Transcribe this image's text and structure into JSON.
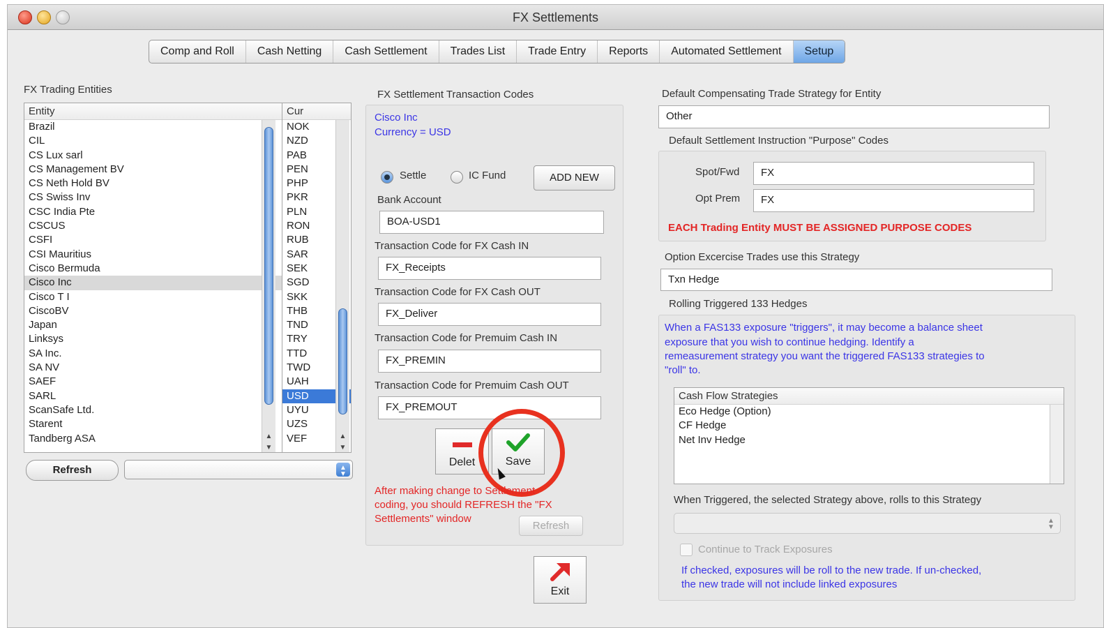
{
  "window": {
    "title": "FX Settlements"
  },
  "tabs": [
    "Comp and Roll",
    "Cash Netting",
    "Cash Settlement",
    "Trades List",
    "Trade Entry",
    "Reports",
    "Automated Settlement",
    "Setup"
  ],
  "entities": {
    "section_label": "FX Trading Entities",
    "entity_header": "Entity",
    "currency_header": "Cur",
    "entity_items": [
      "Brazil",
      "CIL",
      "CS Lux sarl",
      "CS Management BV",
      "CS Neth Hold BV",
      "CS Swiss Inv",
      "CSC India Pte",
      "CSCUS",
      "CSFI",
      "CSI Mauritius",
      "Cisco Bermuda",
      "Cisco Inc",
      "Cisco T I",
      "CiscoBV",
      "Japan",
      "Linksys",
      "SA Inc.",
      "SA NV",
      "SAEF",
      "SARL",
      "ScanSafe Ltd.",
      "Starent",
      "Tandberg ASA"
    ],
    "selected_entity": "Cisco Inc",
    "currency_items": [
      "NOK",
      "NZD",
      "PAB",
      "PEN",
      "PHP",
      "PKR",
      "PLN",
      "RON",
      "RUB",
      "SAR",
      "SEK",
      "SGD",
      "SKK",
      "THB",
      "TND",
      "TRY",
      "TTD",
      "TWD",
      "UAH",
      "USD",
      "UYU",
      "UZS",
      "VEF"
    ],
    "selected_currency": "USD",
    "refresh_label": "Refresh"
  },
  "codes": {
    "section_label": "FX Settlement Transaction Codes",
    "entity_name": "Cisco Inc",
    "currency_line": "Currency = USD",
    "radio_settle": "Settle",
    "radio_icfund": "IC Fund",
    "add_new_label": "ADD NEW",
    "bank_account_label": "Bank Account",
    "bank_account_value": "BOA-USD1",
    "cash_in_label": "Transaction Code for FX Cash IN",
    "cash_in_value": "FX_Receipts",
    "cash_out_label": "Transaction Code for FX Cash OUT",
    "cash_out_value": "FX_Deliver",
    "prem_in_label": "Transaction Code for Premuim Cash IN",
    "prem_in_value": "FX_PREMIN",
    "prem_out_label": "Transaction Code for Premuim Cash OUT",
    "prem_out_value": "FX_PREMOUT",
    "delete_label": "Delet",
    "save_label": "Save",
    "warning_line1": "After making change to Settlement",
    "warning_line2": "coding, you should REFRESH the \"FX",
    "warning_line3": "Settlements\" window",
    "refresh_label": "Refresh",
    "exit_label": "Exit"
  },
  "strategy": {
    "default_comp_label": "Default Compensating Trade Strategy for Entity",
    "default_comp_value": "Other",
    "purpose_label": "Default Settlement Instruction \"Purpose\" Codes",
    "spot_label": "Spot/Fwd",
    "spot_value": "FX",
    "opt_label": "Opt Prem",
    "opt_value": "FX",
    "purpose_warning": "EACH Trading Entity MUST BE ASSIGNED PURPOSE CODES",
    "option_ex_label": "Option Excercise Trades use this Strategy",
    "option_ex_value": "Txn Hedge",
    "rolling_label": "Rolling Triggered 133 Hedges",
    "rolling_desc_1": "When a FAS133 exposure \"triggers\", it may become a balance sheet",
    "rolling_desc_2": "exposure that you wish to continue hedging.  Identify a",
    "rolling_desc_3": "remeasurement strategy you want the triggered FAS133 strategies to",
    "rolling_desc_4": "\"roll\" to.",
    "cf_header": "Cash Flow Strategies",
    "cf_items": [
      "Eco Hedge (Option)",
      "CF Hedge",
      "Net Inv Hedge"
    ],
    "triggered_label": "When Triggered, the selected Strategy above, rolls to this Strategy",
    "continue_label": "Continue to Track Exposures",
    "note_1": "If checked, exposures will be roll to the new trade.  If un-checked,",
    "note_2": "the new trade will not include linked exposures"
  },
  "colors": {
    "accent_blue": "#3b35e6",
    "warning_red": "#e32626",
    "highlight_circle": "#e8311f",
    "selection_blue": "#3b7ad8"
  }
}
